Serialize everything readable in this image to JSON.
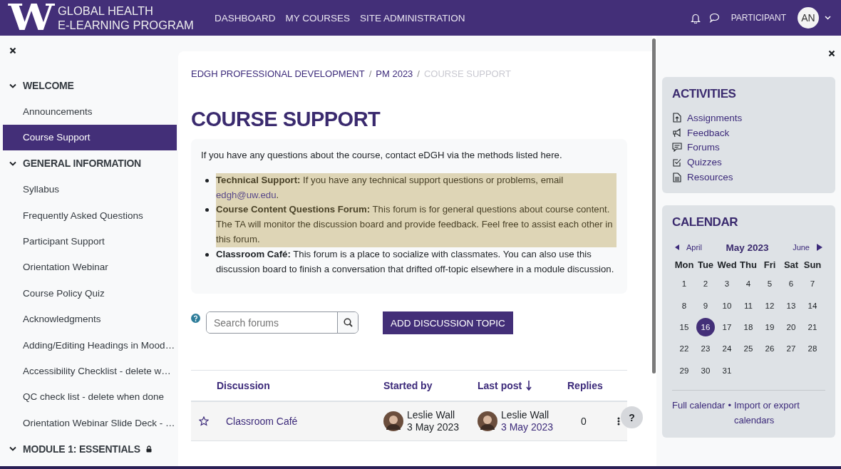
{
  "header": {
    "logo": "W",
    "brand_lines": [
      "GLOBAL HEALTH",
      "E-LEARNING PROGRAM"
    ],
    "nav": [
      "DASHBOARD",
      "MY COURSES",
      "SITE ADMINISTRATION"
    ],
    "role": "PARTICIPANT",
    "avatar": "AN"
  },
  "left_drawer": {
    "sections": [
      {
        "title": "WELCOME",
        "expanded": true,
        "locked": false,
        "items": [
          {
            "label": "Announcements",
            "selected": false
          },
          {
            "label": "Course Support",
            "selected": true
          }
        ]
      },
      {
        "title": "GENERAL INFORMATION",
        "expanded": true,
        "locked": false,
        "items": [
          {
            "label": "Syllabus",
            "selected": false
          },
          {
            "label": "Frequently Asked Questions",
            "selected": false
          },
          {
            "label": "Participant Support",
            "selected": false
          },
          {
            "label": "Orientation Webinar",
            "selected": false
          },
          {
            "label": "Course Policy Quiz",
            "selected": false
          },
          {
            "label": "Acknowledgments",
            "selected": false
          },
          {
            "label": "Adding/Editing Headings in Mood…",
            "selected": false
          },
          {
            "label": "Accessibility Checklist - delete w…",
            "selected": false
          },
          {
            "label": "QC check list - delete when done",
            "selected": false
          },
          {
            "label": "Orientation Webinar Slide Deck - …",
            "selected": false
          }
        ]
      },
      {
        "title": "MODULE 1: ESSENTIALS",
        "expanded": true,
        "locked": true
      }
    ]
  },
  "breadcrumb_separator": "/",
  "breadcrumb": [
    {
      "label": "EDGH PROFESSIONAL DEVELOPMENT",
      "current": false
    },
    {
      "label": "PM 2023",
      "current": false
    },
    {
      "label": "COURSE SUPPORT",
      "current": true
    }
  ],
  "page_title": "COURSE SUPPORT",
  "intro_box": {
    "intro": "If you have any questions about the course, contact eDGH via the methods listed here.",
    "bullets": [
      {
        "text": "**Technical Support:** If you have any technical support questions or problems, email",
        "link": "edgh@uw.edu",
        "after": ".",
        "highlighted": true
      },
      {
        "text": "**Course Content Questions Forum:** This forum is for general questions about course content. The TA will monitor the discussion board and provide feedback. Feel free to assist each other in this forum.",
        "highlighted": true
      },
      {
        "text": "**Classroom Café:** This forum is a place to socialize with classmates. You can also use this discussion board to finish a conversation that drifted off-topic elsewhere in a module discussion.",
        "highlighted": false
      }
    ]
  },
  "forum_tools": {
    "search_placeholder": "Search forums",
    "add_button": "ADD DISCUSSION TOPIC"
  },
  "discussions": {
    "columns": [
      "Discussion",
      "Started by",
      "Last post",
      "Replies"
    ],
    "rows": [
      {
        "starred": false,
        "title": "Classroom Café",
        "started_by": {
          "name": "Leslie Wall",
          "date": "3 May 2023"
        },
        "last_post": {
          "name": "Leslie Wall",
          "date": "3 May 2023"
        },
        "replies": "0"
      }
    ]
  },
  "help_button": "?",
  "right_drawer": {
    "activities": {
      "title": "ACTIVITIES",
      "items": [
        {
          "kind": "assignment",
          "label": "Assignments"
        },
        {
          "kind": "feedback",
          "label": "Feedback"
        },
        {
          "kind": "forum",
          "label": "Forums"
        },
        {
          "kind": "quiz",
          "label": "Quizzes"
        },
        {
          "kind": "resource",
          "label": "Resources"
        }
      ]
    },
    "calendar": {
      "title": "CALENDAR",
      "prev": "April",
      "month": "May 2023",
      "next": "June",
      "weekdays": [
        "Mon",
        "Tue",
        "Wed",
        "Thu",
        "Fri",
        "Sat",
        "Sun"
      ],
      "weeks": [
        [
          {
            "day": "1",
            "selected": false
          },
          {
            "day": "2",
            "selected": false
          },
          {
            "day": "3",
            "selected": false
          },
          {
            "day": "4",
            "selected": false
          },
          {
            "day": "5",
            "selected": false
          },
          {
            "day": "6",
            "selected": false
          },
          {
            "day": "7",
            "selected": false
          }
        ],
        [
          {
            "day": "8",
            "selected": false
          },
          {
            "day": "9",
            "selected": false
          },
          {
            "day": "10",
            "selected": false
          },
          {
            "day": "11",
            "selected": false
          },
          {
            "day": "12",
            "selected": false
          },
          {
            "day": "13",
            "selected": false
          },
          {
            "day": "14",
            "selected": false
          }
        ],
        [
          {
            "day": "15",
            "selected": false
          },
          {
            "day": "16",
            "selected": true
          },
          {
            "day": "17",
            "selected": false
          },
          {
            "day": "18",
            "selected": false
          },
          {
            "day": "19",
            "selected": false
          },
          {
            "day": "20",
            "selected": false
          },
          {
            "day": "21",
            "selected": false
          }
        ],
        [
          {
            "day": "22",
            "selected": false
          },
          {
            "day": "23",
            "selected": false
          },
          {
            "day": "24",
            "selected": false
          },
          {
            "day": "25",
            "selected": false
          },
          {
            "day": "26",
            "selected": false
          },
          {
            "day": "27",
            "selected": false
          },
          {
            "day": "28",
            "selected": false
          }
        ],
        [
          {
            "day": "29",
            "selected": false
          },
          {
            "day": "30",
            "selected": false
          },
          {
            "day": "31",
            "selected": false
          }
        ]
      ],
      "footer_links": [
        "Full calendar",
        "Import or export calendars"
      ],
      "separator": "•"
    }
  }
}
